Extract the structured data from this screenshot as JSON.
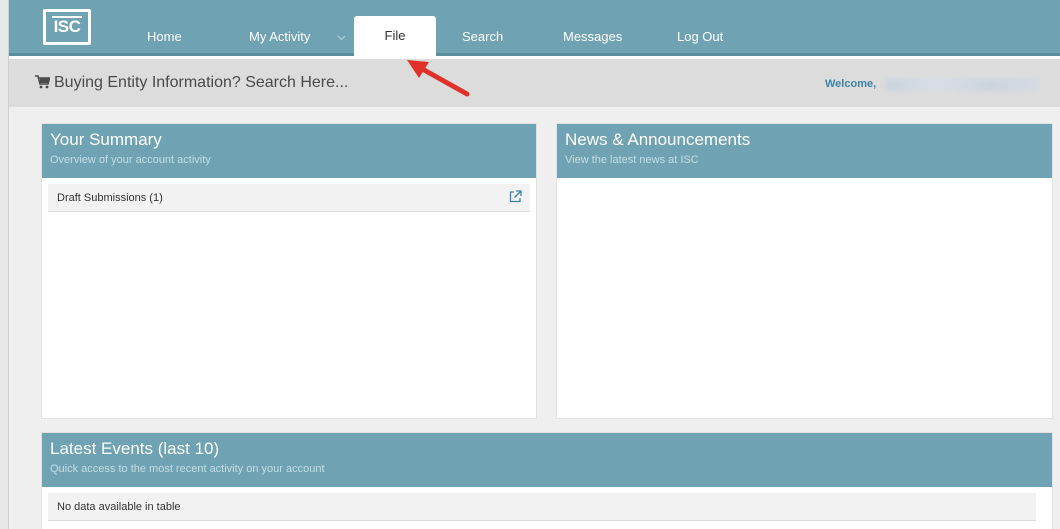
{
  "nav": {
    "logo": "ISC",
    "items": [
      {
        "label": "Home"
      },
      {
        "label": "My Activity"
      },
      {
        "label": "File"
      },
      {
        "label": "Search"
      },
      {
        "label": "Messages"
      },
      {
        "label": "Log Out"
      }
    ],
    "active": "File"
  },
  "searchbar": {
    "text": "Buying Entity Information? Search Here...",
    "welcome": "Welcome,"
  },
  "summary": {
    "title": "Your Summary",
    "subtitle": "Overview of your account activity",
    "rows": [
      {
        "label": "Draft Submissions (1)"
      }
    ]
  },
  "news": {
    "title": "News & Announcements",
    "subtitle": "View the latest news at ISC"
  },
  "events": {
    "title": "Latest Events (last 10)",
    "subtitle": "Quick access to the most recent activity on your account",
    "empty_text": "No data available in table"
  },
  "colors": {
    "header": "#6fa3b3",
    "accent": "#3b84a8",
    "arrow": "#e0302a"
  },
  "icons": {
    "cart": "shopping-cart-icon",
    "external": "external-link-icon",
    "dropdown": "chevron-down-icon"
  }
}
